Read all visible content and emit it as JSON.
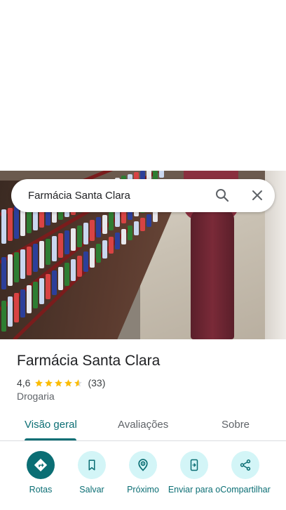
{
  "search": {
    "query": "Farmácia Santa Clara"
  },
  "place": {
    "title": "Farmácia Santa Clara",
    "rating": "4,6",
    "rating_value": 4.6,
    "review_count": "(33)",
    "category": "Drogaria"
  },
  "tabs": [
    {
      "label": "Visão geral",
      "active": true
    },
    {
      "label": "Avaliações",
      "active": false
    },
    {
      "label": "Sobre",
      "active": false
    }
  ],
  "actions": [
    {
      "label": "Rotas",
      "icon": "directions-icon",
      "primary": true
    },
    {
      "label": "Salvar",
      "icon": "bookmark-icon",
      "primary": false
    },
    {
      "label": "Próximo",
      "icon": "nearby-icon",
      "primary": false
    },
    {
      "label": "Enviar para o",
      "icon": "send-to-phone-icon",
      "primary": false
    },
    {
      "label": "Compartilhar",
      "icon": "share-icon",
      "primary": false
    }
  ],
  "colors": {
    "accent": "#0b6e74",
    "accent_light": "#d3f5f7",
    "star": "#fbbc04"
  }
}
